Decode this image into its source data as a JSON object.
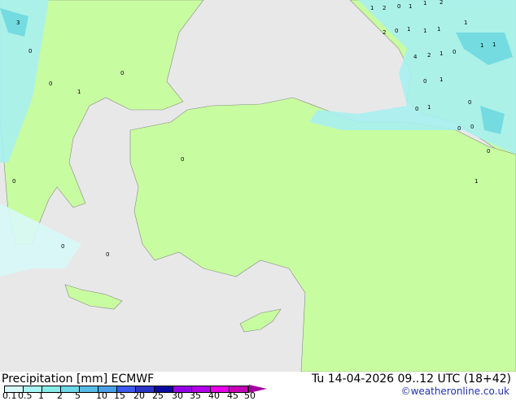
{
  "colors": {
    "sea": "#e8e8e8",
    "land": "#c8fca0",
    "light_precip": "#a8f0f0",
    "mid_precip": "#6cd8e8",
    "border": "#888888"
  },
  "footer": {
    "title": "Precipitation [mm]  ECMWF",
    "datetime": "Tu 14-04-2026 09..12 UTC (18+42)",
    "credit": "©weatheronline.co.uk"
  },
  "legend": {
    "ticks": [
      "0.1",
      "0.5",
      "1",
      "2",
      "5",
      "10",
      "15",
      "20",
      "25",
      "30",
      "35",
      "40",
      "45",
      "50"
    ],
    "colors": [
      "#d8f8f8",
      "#a8f4f4",
      "#88ece8",
      "#6cd8e8",
      "#58bce8",
      "#4aa0e8",
      "#3c5af0",
      "#2a36c8",
      "#0a0aa0",
      "#9400e8",
      "#b400e8",
      "#e800e8",
      "#c800b8"
    ]
  },
  "map_labels": [
    "1",
    "2",
    "0",
    "1",
    "1",
    "2",
    "2",
    "0",
    "1",
    "1",
    "1",
    "1",
    "4",
    "2",
    "1",
    "0",
    "1",
    "1",
    "0",
    "1",
    "0",
    "1",
    "0",
    "0",
    "0",
    "0",
    "1",
    "3",
    "0",
    "0",
    "1",
    "0",
    "0",
    "0",
    "0",
    "0"
  ]
}
